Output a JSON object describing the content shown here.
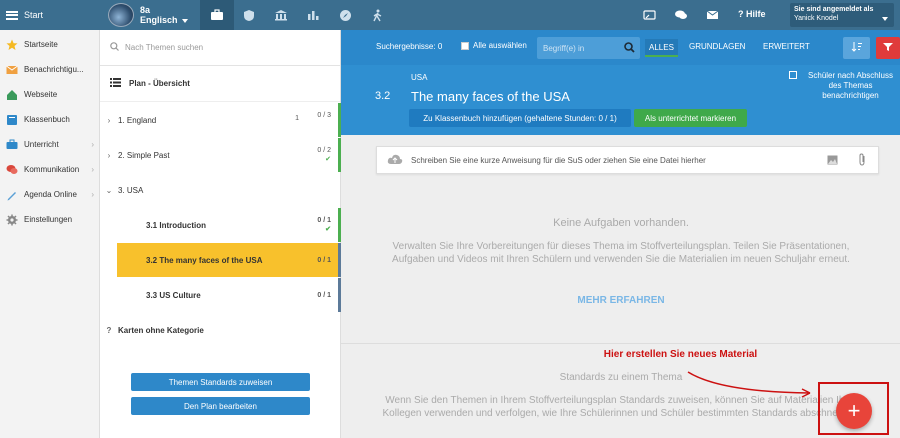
{
  "topbar": {
    "start_label": "Start",
    "class_name": "8a",
    "subject": "Englisch",
    "help_label": "Hilfe",
    "user_label": "Sie sind angemeldet als",
    "user_name": "Yanick Knodel"
  },
  "nav": {
    "items": [
      {
        "label": "Startseite",
        "icon": "star-icon"
      },
      {
        "label": "Benachrichtigu...",
        "icon": "envelope-icon"
      },
      {
        "label": "Webseite",
        "icon": "house-icon"
      },
      {
        "label": "Klassenbuch",
        "icon": "book-icon"
      },
      {
        "label": "Unterricht",
        "icon": "briefcase-icon"
      },
      {
        "label": "Kommunikation",
        "icon": "chat-icon"
      },
      {
        "label": "Agenda Online",
        "icon": "pen-icon"
      },
      {
        "label": "Einstellungen",
        "icon": "gear-icon"
      }
    ]
  },
  "topics": {
    "search_placeholder": "Nach Themen suchen",
    "plan_title": "Plan - Übersicht",
    "rows": [
      {
        "label": "1. England",
        "count": "0 / 3",
        "mini": "1"
      },
      {
        "label": "2. Simple Past",
        "count": "0 / 2"
      },
      {
        "label": "3. USA"
      },
      {
        "label": "3.1  Introduction",
        "count": "0 / 1"
      },
      {
        "label": "3.2  The many faces of the USA",
        "count": "0 / 1"
      },
      {
        "label": "3.3  US Culture",
        "count": "0 / 1"
      },
      {
        "label": "Karten ohne Kategorie",
        "marker": "?"
      }
    ],
    "assign_btn": "Themen Standards zuweisen",
    "edit_btn": "Den Plan bearbeiten"
  },
  "filter": {
    "results": "Suchergebnisse: 0",
    "select_all": "Alle auswählen",
    "search_placeholder": "Begriff(e) in",
    "tabs": [
      "ALLES",
      "GRUNDLAGEN",
      "ERWEITERT"
    ]
  },
  "header": {
    "parent": "USA",
    "number": "3.2",
    "title": "The many faces of the USA",
    "add_btn": "Zu Klassenbuch hinzufügen (gehaltene Stunden: 0 / 1)",
    "mark_btn": "Als unterrichtet markieren",
    "checkbox_label": "Schüler nach Abschluss des Themas benachrichtigen"
  },
  "content": {
    "upload_placeholder": "Schreiben Sie eine kurze Anweisung für die SuS oder ziehen Sie eine Datei hierher",
    "no_tasks": "Keine Aufgaben vorhanden.",
    "manage_text": "Verwalten Sie Ihre Vorbereitungen für dieses Thema im Stoffverteilungsplan. Teilen Sie Präsentationen, Aufgaben und Videos mit Ihren Schülern und verwenden Sie die Materialien im neuen Schuljahr erneut.",
    "more_link": "MEHR ERFAHREN",
    "standards_title": "Standards zu einem Thema",
    "standards_text": "Wenn Sie den Themen in Ihrem Stoffverteilungsplan Standards zuweisen, können Sie auf Materialien Ihrer Kollegen verwenden und verfolgen, wie Ihre Schülerinnen und Schüler bestimmten Standards abschneiden.",
    "annotation": "Hier erstellen Sie neues Material",
    "fab_label": "+"
  },
  "colors": {
    "topbar": "#3b6e8f",
    "accent": "#2b88cb",
    "selected": "#f8c12c",
    "progress_green": "#4caf50",
    "fab": "#e8443a"
  }
}
